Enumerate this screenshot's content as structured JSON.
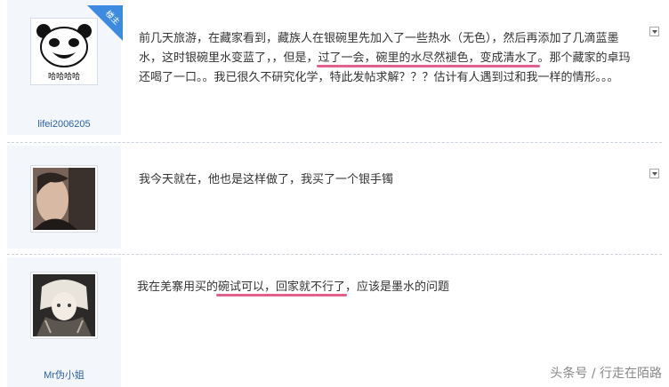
{
  "posts": [
    {
      "username": "lifei2006205",
      "badge": "楼主",
      "avatar": "panda-meme-avatar",
      "avatar_caption": "哈哈哈哈",
      "text_before": "前几天旅游，在藏家看到，藏族人在银碗里先加入了一些热水（无色），然后再添加了几滴蓝墨水，这时银碗里水变蓝了，，但是，",
      "text_highlight": "过了一会，碗里的水尽然褪色，变成清水了",
      "text_after": "。那个藏家的卓玛还喝了一口。。我已很久不研究化学，特此发帖求解？？？估计有人遇到过和我一样的情形。。。"
    },
    {
      "username": "",
      "avatar": "person-photo-avatar",
      "text_before": "我今天就在，他也是这样做了，我买了一个银手镯",
      "text_highlight": "",
      "text_after": ""
    },
    {
      "username": "Mr伪小姐",
      "avatar": "anime-character-avatar",
      "text_before": "我在羌寨用买的",
      "text_highlight": "碗试可以，回家就不行了",
      "text_after": "，应该是墨水的问题"
    }
  ],
  "watermark": "头条号 / 行走在陌路",
  "colors": {
    "sidebar_bg": "#f3f6fa",
    "username": "#2a62a6",
    "highlight_underline": "#e4608a",
    "badge": "#3d8be0"
  }
}
